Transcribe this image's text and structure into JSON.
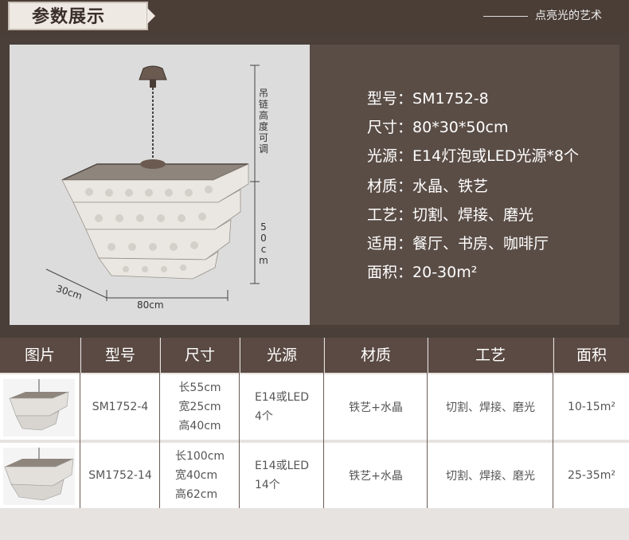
{
  "header": {
    "title": "参数展示",
    "slogan": "点亮光的艺术"
  },
  "hero": {
    "dims": {
      "height_vertical": "吊链高度可调",
      "height_value": "50cm",
      "depth": "30cm",
      "width": "80cm"
    },
    "specs": [
      {
        "label": "型号：",
        "value": "SM1752-8"
      },
      {
        "label": "尺寸：",
        "value": "80*30*50cm"
      },
      {
        "label": "光源：",
        "value": "E14灯泡或LED光源*8个"
      },
      {
        "label": "材质：",
        "value": "水晶、铁艺"
      },
      {
        "label": "工艺：",
        "value": "切割、焊接、磨光"
      },
      {
        "label": "适用：",
        "value": "餐厅、书房、咖啡厅"
      },
      {
        "label": "面积：",
        "value": "20-30m²"
      }
    ]
  },
  "table": {
    "headers": [
      "图片",
      "型号",
      "尺寸",
      "光源",
      "材质",
      "工艺",
      "面积"
    ],
    "rows": [
      {
        "model": "SM1752-4",
        "size": [
          "长55cm",
          "宽25cm",
          "高40cm"
        ],
        "light": [
          "E14或LED",
          "4个"
        ],
        "material": "铁艺+水晶",
        "craft": "切割、焊接、磨光",
        "area": "10-15m²"
      },
      {
        "model": "SM1752-14",
        "size": [
          "长100cm",
          "宽40cm",
          "高62cm"
        ],
        "light": [
          "E14或LED",
          "14个"
        ],
        "material": "铁艺+水晶",
        "craft": "切割、焊接、磨光",
        "area": "25-35m²"
      }
    ]
  },
  "colors": {
    "background": "#4a3f39",
    "panel": "#5a4d46",
    "header_cells": "#5a4a43",
    "title_tab": "#efe9e3"
  },
  "icons": [
    "chandelier-image"
  ]
}
